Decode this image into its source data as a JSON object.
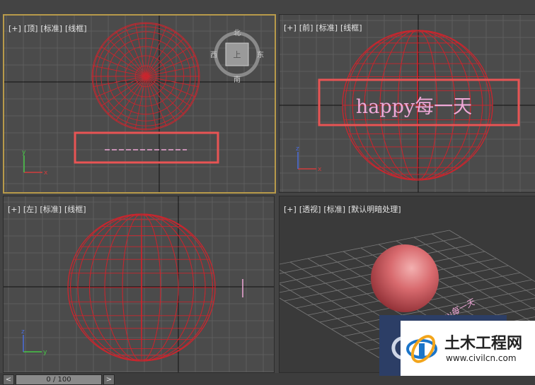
{
  "viewports": {
    "top": {
      "labels": [
        "[+]",
        "[顶]",
        "[标准]",
        "[线框]"
      ],
      "viewcube": {
        "north": "北",
        "south": "南",
        "east": "东",
        "west": "西",
        "face": "上"
      },
      "axes": {
        "x": "x",
        "y": "y"
      }
    },
    "front": {
      "labels": [
        "[+]",
        "[前]",
        "[标准]",
        "[线框]"
      ],
      "text": "happy每一天",
      "axes": {
        "x": "x",
        "z": "z"
      }
    },
    "left": {
      "labels": [
        "[+]",
        "[左]",
        "[标准]",
        "[线框]"
      ],
      "axes": {
        "y": "y",
        "z": "z"
      }
    },
    "perspective": {
      "labels": [
        "[+]",
        "[透视]",
        "[标准]",
        "[默认明暗处理]"
      ],
      "text": "py每一天"
    }
  },
  "timebar": {
    "prev": "<",
    "position": "0 / 100",
    "next": ">"
  },
  "watermark": {
    "title": "土木工程网",
    "url": "www.civilcn.com"
  },
  "colors": {
    "wire": "#c8262e",
    "highlight": "#e85454",
    "text": "#f0a8d8",
    "active_border": "#b89a4a"
  }
}
